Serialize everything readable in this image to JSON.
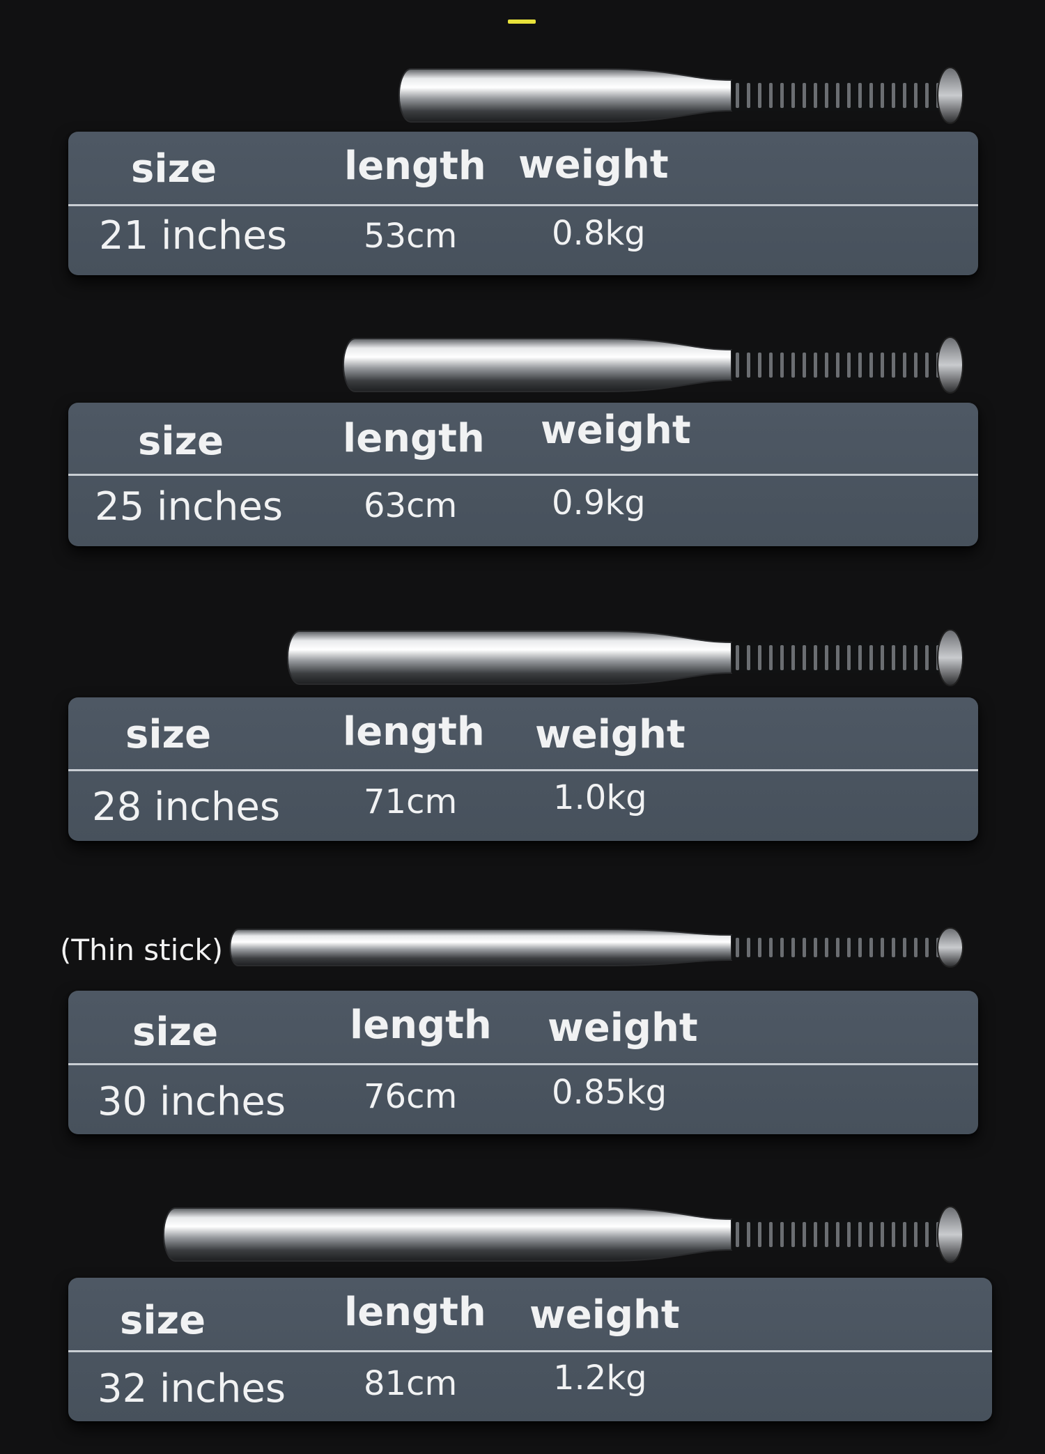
{
  "headers": {
    "size": "size",
    "length": "length",
    "weight": "weight"
  },
  "thin_label": "(Thin stick)",
  "rows": [
    {
      "size": "21 inches",
      "length": "53cm",
      "weight": "0.8kg"
    },
    {
      "size": "25 inches",
      "length": "63cm",
      "weight": "0.9kg"
    },
    {
      "size": "28 inches",
      "length": "71cm",
      "weight": "1.0kg"
    },
    {
      "size": "30 inches",
      "length": "76cm",
      "weight": "0.85kg"
    },
    {
      "size": "32 inches",
      "length": "81cm",
      "weight": "1.2kg"
    }
  ],
  "colors": {
    "background": "#111112",
    "card": "#4b5560",
    "accent": "#e8e23a"
  }
}
